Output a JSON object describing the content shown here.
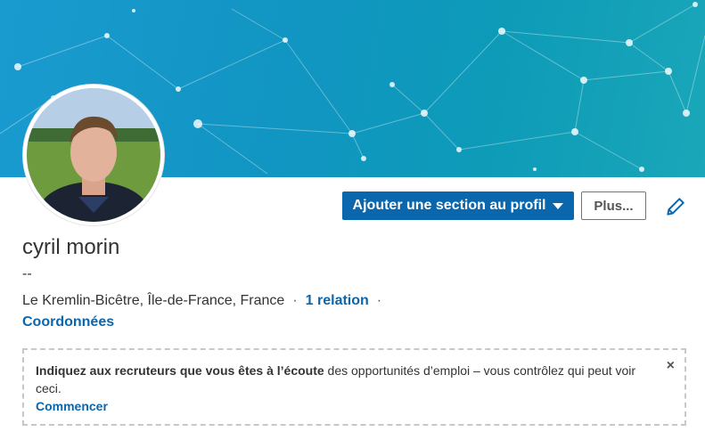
{
  "profile": {
    "name": "cyril morin",
    "headline": "--",
    "location": "Le Kremlin-Bicêtre, Île-de-France, France",
    "separator": "·",
    "connections": "1 relation",
    "contact_link": "Coordonnées"
  },
  "actions": {
    "add_section_label": "Ajouter une section au profil",
    "more_label": "Plus..."
  },
  "notice": {
    "bold_text": "Indiquez aux recruteurs que vous êtes à l’écoute",
    "rest_text": " des opportunités d’emploi – vous contrôlez qui peut voir ceci.",
    "cta": "Commencer",
    "close_symbol": "×"
  },
  "icons": {
    "edit": "pencil-icon",
    "dropdown": "caret-down-icon",
    "close": "close-icon"
  },
  "colors": {
    "brand_blue": "#0a66ad",
    "banner_teal": "#1195c2"
  }
}
